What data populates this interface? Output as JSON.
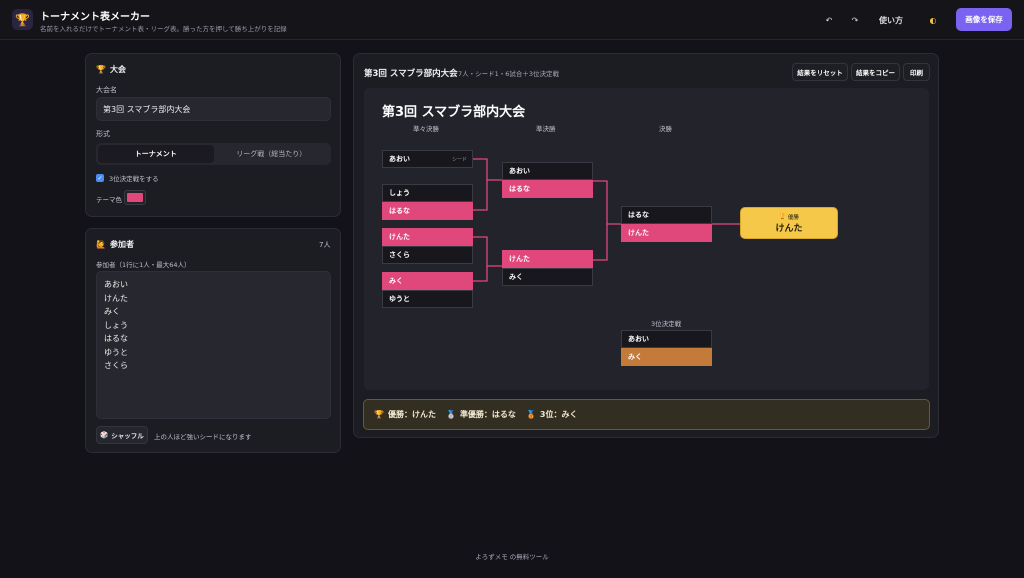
{
  "header": {
    "title": "トーナメント表メーカー",
    "subtitle": "名前を入れるだけでトーナメント表・リーグ表。勝った方を押して勝ち上がりを記録",
    "undo": "↶",
    "redo": "↷",
    "help_label": "使い方",
    "theme_toggle": "◐",
    "save_label": "画像を保存"
  },
  "settings": {
    "title": "大会",
    "name_label": "大会名",
    "name_value": "第3回 スマブラ部内大会",
    "format_label": "形式",
    "formats": [
      "トーナメント",
      "リーグ戦（総当たり）"
    ],
    "third_place_label": "3位決定戦をする",
    "theme_color_label": "テーマ色",
    "theme_color": "#e0487c"
  },
  "participants": {
    "title": "参加者",
    "count": "7人",
    "list_label": "参加者（1行に1人・最大64人）",
    "names": [
      "あおい",
      "けんた",
      "みく",
      "しょう",
      "はるな",
      "ゆうと",
      "さくら"
    ],
    "shuffle_label": "シャッフル",
    "hint": "上の人ほど強いシードになります"
  },
  "bracket": {
    "title": "第3回 スマブラ部内大会",
    "meta": "7人・シード1・6試合＋3位決定戦",
    "reset_label": "結果をリセット",
    "copy_label": "結果をコピー",
    "print_label": "印刷",
    "inner_title": "第3回 スマブラ部内大会",
    "rounds": [
      "準々決勝",
      "準決勝",
      "決勝"
    ],
    "seed_tag": "シード",
    "qf": [
      [
        "あおい"
      ],
      [
        "しょう",
        "はるな"
      ],
      [
        "けんた",
        "さくら"
      ],
      [
        "みく",
        "ゆうと"
      ]
    ],
    "sf": [
      [
        "あおい",
        "はるな"
      ],
      [
        "けんた",
        "みく"
      ]
    ],
    "final": [
      "はるな",
      "けんた"
    ],
    "champion_label": "優勝",
    "champion_name": "けんた",
    "third_title": "3位決定戦",
    "third": [
      "あおい",
      "みく"
    ]
  },
  "results": {
    "first": "優勝：けんた",
    "second": "準優勝：はるな",
    "third": "3位：みく"
  },
  "colors": {
    "accent": "#7a63f0",
    "winner": "#e0487c",
    "gold": "#f5c84a",
    "bronze": "#c47a38"
  },
  "footer": "よろずメモ の無料ツール"
}
